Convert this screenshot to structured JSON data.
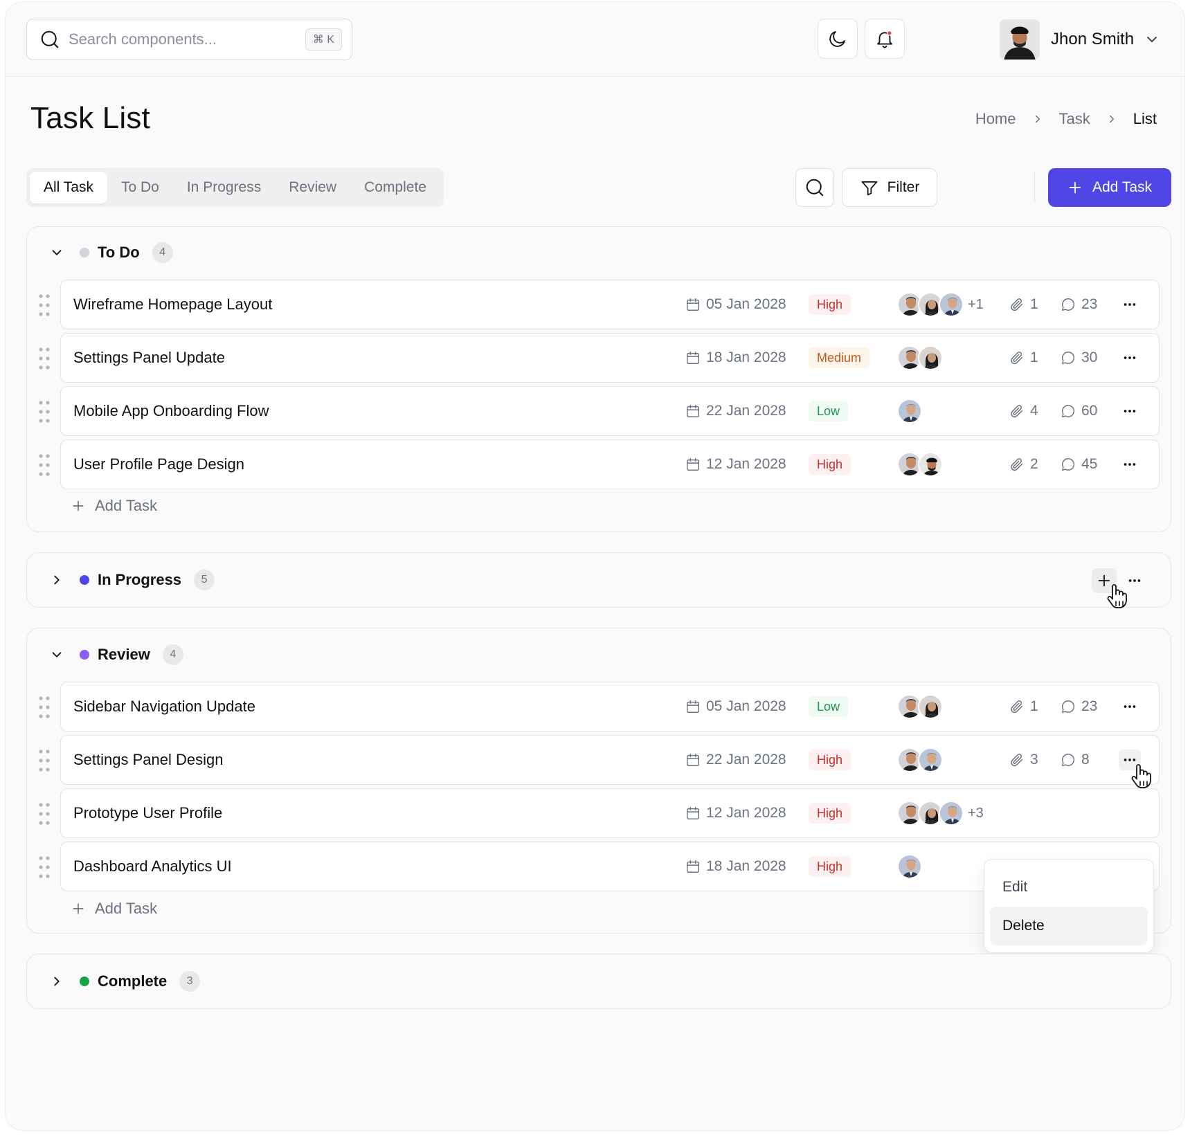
{
  "search": {
    "placeholder": "Search components...",
    "shortcut": "⌘ K"
  },
  "user": {
    "name": "Jhon Smith"
  },
  "page": {
    "title": "Task List"
  },
  "breadcrumb": [
    "Home",
    "Task",
    "List"
  ],
  "tabs": [
    "All Task",
    "To Do",
    "In Progress",
    "Review",
    "Complete"
  ],
  "toolbar": {
    "filter_label": "Filter",
    "add_label": "Add Task"
  },
  "colors": {
    "accent": "#4f46e5",
    "todo": "#d1d5db",
    "in_progress": "#4f46e5",
    "review": "#8b5cf6",
    "complete": "#16a34a",
    "notification": "#ef4444"
  },
  "groups": {
    "todo": {
      "name": "To Do",
      "count": "4",
      "tasks": [
        {
          "name": "Wireframe Homepage Layout",
          "date": "05 Jan 2028",
          "priority": "High",
          "extra": "+1",
          "attachments": "1",
          "comments": "23"
        },
        {
          "name": "Settings Panel Update",
          "date": "18 Jan 2028",
          "priority": "Medium",
          "extra": "",
          "attachments": "1",
          "comments": "30"
        },
        {
          "name": "Mobile App Onboarding Flow",
          "date": "22 Jan 2028",
          "priority": "Low",
          "extra": "",
          "attachments": "4",
          "comments": "60"
        },
        {
          "name": "User Profile Page Design",
          "date": "12 Jan 2028",
          "priority": "High",
          "extra": "",
          "attachments": "2",
          "comments": "45"
        }
      ],
      "add_label": "Add Task"
    },
    "in_progress": {
      "name": "In Progress",
      "count": "5"
    },
    "review": {
      "name": "Review",
      "count": "4",
      "tasks": [
        {
          "name": "Sidebar Navigation Update",
          "date": "05 Jan 2028",
          "priority": "Low",
          "extra": "",
          "attachments": "1",
          "comments": "23"
        },
        {
          "name": "Settings Panel Design",
          "date": "22 Jan 2028",
          "priority": "High",
          "extra": "",
          "attachments": "3",
          "comments": "8"
        },
        {
          "name": "Prototype User Profile",
          "date": "12 Jan 2028",
          "priority": "High",
          "extra": "+3"
        },
        {
          "name": "Dashboard Analytics UI",
          "date": "18 Jan 2028",
          "priority": "High",
          "extra": ""
        }
      ],
      "add_label": "Add Task"
    },
    "complete": {
      "name": "Complete",
      "count": "3"
    }
  },
  "context_menu": {
    "items": [
      "Edit",
      "Delete"
    ]
  },
  "icons": [
    "search-icon",
    "moon-icon",
    "bell-icon",
    "chevron-down-icon",
    "chevron-right-icon",
    "filter-icon",
    "plus-icon",
    "grip-icon",
    "calendar-icon",
    "paperclip-icon",
    "comment-icon",
    "more-icon",
    "hand-cursor-icon"
  ]
}
